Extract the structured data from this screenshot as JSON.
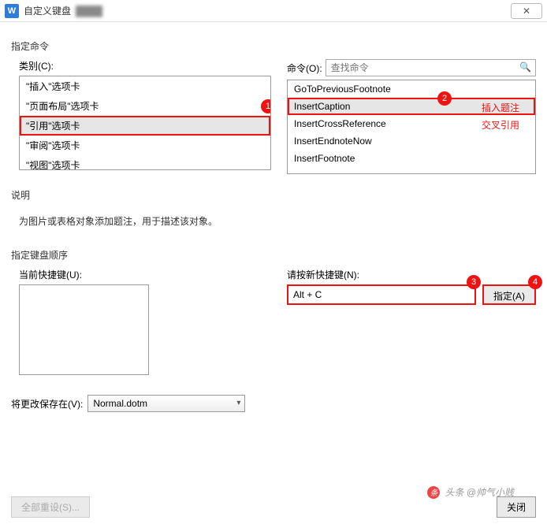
{
  "titlebar": {
    "icon": "W",
    "title": "自定义键盘",
    "close": "✕"
  },
  "sections": {
    "assign_cmd": "指定命令",
    "description_label": "说明",
    "keyboard_seq": "指定键盘顺序"
  },
  "category": {
    "label": "类别(C):",
    "items": [
      "\"插入\"选项卡",
      "\"页面布局\"选项卡",
      "\"引用\"选项卡",
      "\"审阅\"选项卡",
      "\"视图\"选项卡"
    ],
    "selected_index": 2
  },
  "commands": {
    "label": "命令(O):",
    "search_placeholder": "查找命令",
    "items": [
      "GoToPreviousFootnote",
      "InsertCaption",
      "InsertCrossReference",
      "InsertEndnoteNow",
      "InsertFootnote"
    ],
    "selected_index": 1,
    "annotations": {
      "1": "插入题注",
      "2": "交叉引用"
    }
  },
  "description": "为图片或表格对象添加题注，用于描述该对象。",
  "shortcuts": {
    "current_label": "当前快捷键(U):",
    "new_label": "请按新快捷键(N):",
    "new_value": "Alt + C",
    "assign_btn": "指定(A)"
  },
  "save_in": {
    "label": "将更改保存在(V):",
    "value": "Normal.dotm"
  },
  "footer": {
    "reset": "全部重设(S)...",
    "close": "关闭"
  },
  "badges": {
    "b1": "1",
    "b2": "2",
    "b3": "3",
    "b4": "4"
  },
  "watermark": "头条 @帅气小贱"
}
